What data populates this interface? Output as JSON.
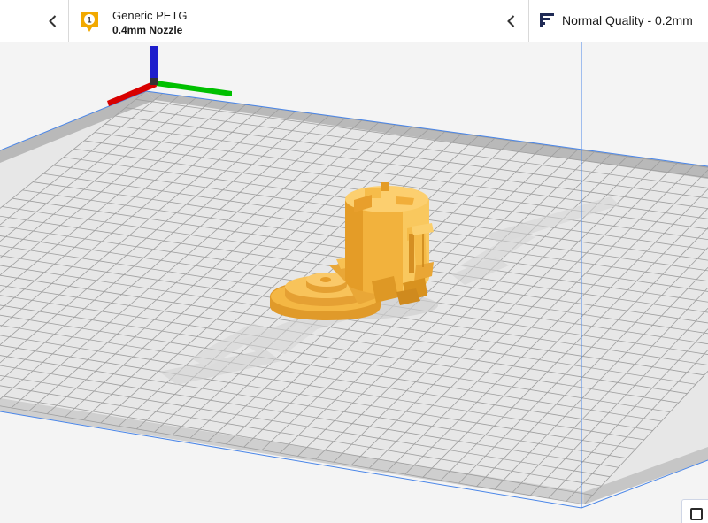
{
  "toolbar": {
    "material": {
      "extruder_number": "1",
      "name": "Generic PETG",
      "nozzle": "0.4mm Nozzle"
    },
    "quality": {
      "label": "Normal Quality - 0.2mm"
    }
  },
  "colors": {
    "accent": "#f2a900",
    "model": "#f5b94a",
    "axis_x": "#d80000",
    "axis_y": "#00c000",
    "axis_z": "#1e1ecc",
    "build_volume": "#4a86e8"
  },
  "icons": {
    "material": "extruder-badge-icon",
    "quality": "quality-bars-icon",
    "collapse_left": "chevron-left-icon",
    "collapse_right": "chevron-left-icon"
  }
}
